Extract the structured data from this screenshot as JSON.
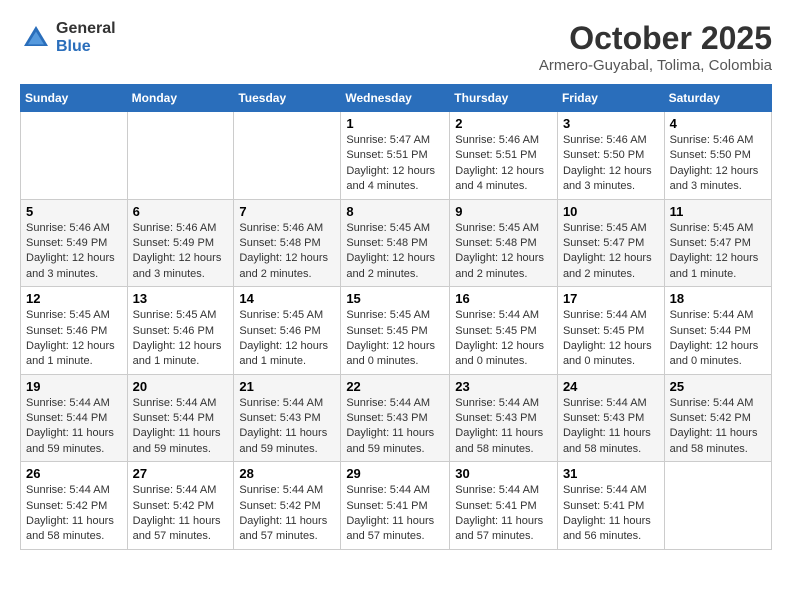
{
  "logo": {
    "general": "General",
    "blue": "Blue"
  },
  "title": "October 2025",
  "location": "Armero-Guyabal, Tolima, Colombia",
  "days_of_week": [
    "Sunday",
    "Monday",
    "Tuesday",
    "Wednesday",
    "Thursday",
    "Friday",
    "Saturday"
  ],
  "weeks": [
    [
      {
        "day": "",
        "content": ""
      },
      {
        "day": "",
        "content": ""
      },
      {
        "day": "",
        "content": ""
      },
      {
        "day": "1",
        "content": "Sunrise: 5:47 AM\nSunset: 5:51 PM\nDaylight: 12 hours\nand 4 minutes."
      },
      {
        "day": "2",
        "content": "Sunrise: 5:46 AM\nSunset: 5:51 PM\nDaylight: 12 hours\nand 4 minutes."
      },
      {
        "day": "3",
        "content": "Sunrise: 5:46 AM\nSunset: 5:50 PM\nDaylight: 12 hours\nand 3 minutes."
      },
      {
        "day": "4",
        "content": "Sunrise: 5:46 AM\nSunset: 5:50 PM\nDaylight: 12 hours\nand 3 minutes."
      }
    ],
    [
      {
        "day": "5",
        "content": "Sunrise: 5:46 AM\nSunset: 5:49 PM\nDaylight: 12 hours\nand 3 minutes."
      },
      {
        "day": "6",
        "content": "Sunrise: 5:46 AM\nSunset: 5:49 PM\nDaylight: 12 hours\nand 3 minutes."
      },
      {
        "day": "7",
        "content": "Sunrise: 5:46 AM\nSunset: 5:48 PM\nDaylight: 12 hours\nand 2 minutes."
      },
      {
        "day": "8",
        "content": "Sunrise: 5:45 AM\nSunset: 5:48 PM\nDaylight: 12 hours\nand 2 minutes."
      },
      {
        "day": "9",
        "content": "Sunrise: 5:45 AM\nSunset: 5:48 PM\nDaylight: 12 hours\nand 2 minutes."
      },
      {
        "day": "10",
        "content": "Sunrise: 5:45 AM\nSunset: 5:47 PM\nDaylight: 12 hours\nand 2 minutes."
      },
      {
        "day": "11",
        "content": "Sunrise: 5:45 AM\nSunset: 5:47 PM\nDaylight: 12 hours\nand 1 minute."
      }
    ],
    [
      {
        "day": "12",
        "content": "Sunrise: 5:45 AM\nSunset: 5:46 PM\nDaylight: 12 hours\nand 1 minute."
      },
      {
        "day": "13",
        "content": "Sunrise: 5:45 AM\nSunset: 5:46 PM\nDaylight: 12 hours\nand 1 minute."
      },
      {
        "day": "14",
        "content": "Sunrise: 5:45 AM\nSunset: 5:46 PM\nDaylight: 12 hours\nand 1 minute."
      },
      {
        "day": "15",
        "content": "Sunrise: 5:45 AM\nSunset: 5:45 PM\nDaylight: 12 hours\nand 0 minutes."
      },
      {
        "day": "16",
        "content": "Sunrise: 5:44 AM\nSunset: 5:45 PM\nDaylight: 12 hours\nand 0 minutes."
      },
      {
        "day": "17",
        "content": "Sunrise: 5:44 AM\nSunset: 5:45 PM\nDaylight: 12 hours\nand 0 minutes."
      },
      {
        "day": "18",
        "content": "Sunrise: 5:44 AM\nSunset: 5:44 PM\nDaylight: 12 hours\nand 0 minutes."
      }
    ],
    [
      {
        "day": "19",
        "content": "Sunrise: 5:44 AM\nSunset: 5:44 PM\nDaylight: 11 hours\nand 59 minutes."
      },
      {
        "day": "20",
        "content": "Sunrise: 5:44 AM\nSunset: 5:44 PM\nDaylight: 11 hours\nand 59 minutes."
      },
      {
        "day": "21",
        "content": "Sunrise: 5:44 AM\nSunset: 5:43 PM\nDaylight: 11 hours\nand 59 minutes."
      },
      {
        "day": "22",
        "content": "Sunrise: 5:44 AM\nSunset: 5:43 PM\nDaylight: 11 hours\nand 59 minutes."
      },
      {
        "day": "23",
        "content": "Sunrise: 5:44 AM\nSunset: 5:43 PM\nDaylight: 11 hours\nand 58 minutes."
      },
      {
        "day": "24",
        "content": "Sunrise: 5:44 AM\nSunset: 5:43 PM\nDaylight: 11 hours\nand 58 minutes."
      },
      {
        "day": "25",
        "content": "Sunrise: 5:44 AM\nSunset: 5:42 PM\nDaylight: 11 hours\nand 58 minutes."
      }
    ],
    [
      {
        "day": "26",
        "content": "Sunrise: 5:44 AM\nSunset: 5:42 PM\nDaylight: 11 hours\nand 58 minutes."
      },
      {
        "day": "27",
        "content": "Sunrise: 5:44 AM\nSunset: 5:42 PM\nDaylight: 11 hours\nand 57 minutes."
      },
      {
        "day": "28",
        "content": "Sunrise: 5:44 AM\nSunset: 5:42 PM\nDaylight: 11 hours\nand 57 minutes."
      },
      {
        "day": "29",
        "content": "Sunrise: 5:44 AM\nSunset: 5:41 PM\nDaylight: 11 hours\nand 57 minutes."
      },
      {
        "day": "30",
        "content": "Sunrise: 5:44 AM\nSunset: 5:41 PM\nDaylight: 11 hours\nand 57 minutes."
      },
      {
        "day": "31",
        "content": "Sunrise: 5:44 AM\nSunset: 5:41 PM\nDaylight: 11 hours\nand 56 minutes."
      },
      {
        "day": "",
        "content": ""
      }
    ]
  ]
}
